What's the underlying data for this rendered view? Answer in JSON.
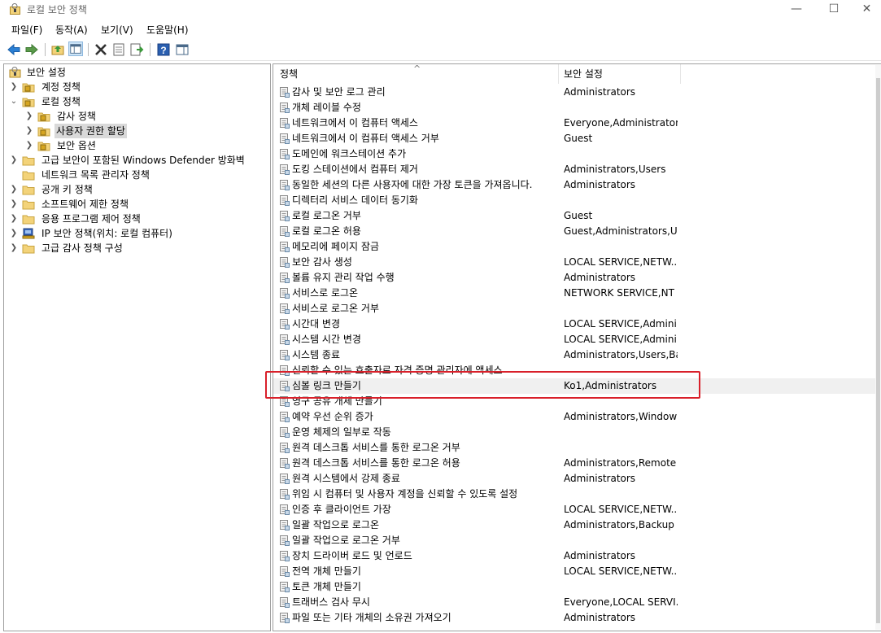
{
  "window": {
    "title": "로컬 보안 정책",
    "minimize": "—",
    "maximize": "☐",
    "close": "✕"
  },
  "menu": [
    "파일(F)",
    "동작(A)",
    "보기(V)",
    "도움말(H)"
  ],
  "tree": [
    {
      "label": "보안 설정",
      "level": 0,
      "chev": "v",
      "icon": "security-settings-icon"
    },
    {
      "label": "계정 정책",
      "level": 1,
      "chev": ">",
      "icon": "folder-lock-icon"
    },
    {
      "label": "로컬 정책",
      "level": 1,
      "chev": "v",
      "icon": "folder-lock-icon"
    },
    {
      "label": "감사 정책",
      "level": 2,
      "chev": ">",
      "icon": "folder-lock-icon"
    },
    {
      "label": "사용자 권한 할당",
      "level": 2,
      "chev": ">",
      "icon": "folder-lock-icon",
      "selected": true
    },
    {
      "label": "보안 옵션",
      "level": 2,
      "chev": ">",
      "icon": "folder-lock-icon"
    },
    {
      "label": "고급 보안이 포함된 Windows Defender 방화벽",
      "level": 1,
      "chev": ">",
      "icon": "folder-icon"
    },
    {
      "label": "네트워크 목록 관리자 정책",
      "level": 1,
      "chev": "",
      "icon": "folder-icon"
    },
    {
      "label": "공개 키 정책",
      "level": 1,
      "chev": ">",
      "icon": "folder-icon"
    },
    {
      "label": "소프트웨어 제한 정책",
      "level": 1,
      "chev": ">",
      "icon": "folder-icon"
    },
    {
      "label": "응용 프로그램 제어 정책",
      "level": 1,
      "chev": ">",
      "icon": "folder-icon"
    },
    {
      "label": "IP 보안 정책(위치: 로컬 컴퓨터)",
      "level": 1,
      "chev": ">",
      "icon": "ip-security-icon"
    },
    {
      "label": "고급 감사 정책 구성",
      "level": 1,
      "chev": ">",
      "icon": "folder-icon"
    }
  ],
  "columns": {
    "policy": "정책",
    "setting": "보안 설정",
    "sort_arrow": "^"
  },
  "rows": [
    {
      "name": "감사 및 보안 로그 관리",
      "value": "Administrators"
    },
    {
      "name": "개체 레이블 수정",
      "value": ""
    },
    {
      "name": "네트워크에서 이 컴퓨터 액세스",
      "value": "Everyone,Administrators..."
    },
    {
      "name": "네트워크에서 이 컴퓨터 액세스 거부",
      "value": "Guest"
    },
    {
      "name": "도메인에 워크스테이션 추가",
      "value": ""
    },
    {
      "name": "도킹 스테이션에서 컴퓨터 제거",
      "value": "Administrators,Users"
    },
    {
      "name": "동일한 세션의 다른 사용자에 대한 가장 토큰을 가져옵니다.",
      "value": "Administrators"
    },
    {
      "name": "디렉터리 서비스 데이터 동기화",
      "value": ""
    },
    {
      "name": "로컬 로그온 거부",
      "value": "Guest"
    },
    {
      "name": "로컬 로그온 허용",
      "value": "Guest,Administrators,Us..."
    },
    {
      "name": "메모리에 페이지 잠금",
      "value": ""
    },
    {
      "name": "보안 감사 생성",
      "value": "LOCAL SERVICE,NETW..."
    },
    {
      "name": "볼륨 유지 관리 작업 수행",
      "value": "Administrators"
    },
    {
      "name": "서비스로 로그온",
      "value": "NETWORK SERVICE,NT ..."
    },
    {
      "name": "서비스로 로그온 거부",
      "value": ""
    },
    {
      "name": "시간대 변경",
      "value": "LOCAL SERVICE,Admini..."
    },
    {
      "name": "시스템 시간 변경",
      "value": "LOCAL SERVICE,Admini..."
    },
    {
      "name": "시스템 종료",
      "value": "Administrators,Users,Ba..."
    },
    {
      "name": "신뢰할 수 있는 호출자로 자격 증명 관리자에 액세스",
      "value": ""
    },
    {
      "name": "심볼 링크 만들기",
      "value": "Ko1,Administrators",
      "highlight": true
    },
    {
      "name": "영구 공유 개체 만들기",
      "value": ""
    },
    {
      "name": "예약 우선 순위 증가",
      "value": "Administrators,Window ..."
    },
    {
      "name": "운영 체제의 일부로 작동",
      "value": ""
    },
    {
      "name": "원격 데스크톱 서비스를 통한 로그온 거부",
      "value": ""
    },
    {
      "name": "원격 데스크톱 서비스를 통한 로그온 허용",
      "value": "Administrators,Remote ..."
    },
    {
      "name": "원격 시스템에서 강제 종료",
      "value": "Administrators"
    },
    {
      "name": "위임 시 컴퓨터 및 사용자 계정을 신뢰할 수 있도록 설정",
      "value": ""
    },
    {
      "name": "인증 후 클라이언트 가장",
      "value": "LOCAL SERVICE,NETW..."
    },
    {
      "name": "일괄 작업으로 로그온",
      "value": "Administrators,Backup ..."
    },
    {
      "name": "일괄 작업으로 로그온 거부",
      "value": ""
    },
    {
      "name": "장치 드라이버 로드 및 언로드",
      "value": "Administrators"
    },
    {
      "name": "전역 개체 만들기",
      "value": "LOCAL SERVICE,NETW..."
    },
    {
      "name": "토큰 개체 만들기",
      "value": ""
    },
    {
      "name": "트래버스 검사 무시",
      "value": "Everyone,LOCAL SERVI..."
    },
    {
      "name": "파일 또는 기타 개체의 소유권 가져오기",
      "value": "Administrators"
    }
  ]
}
